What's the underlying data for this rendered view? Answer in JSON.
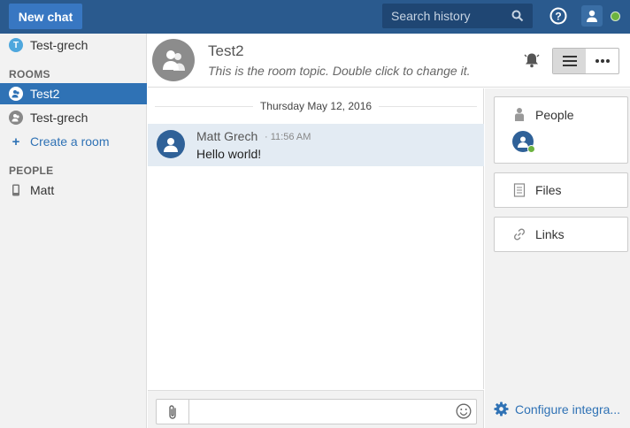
{
  "topbar": {
    "new_chat_label": "New chat",
    "search_placeholder": "Search history"
  },
  "sidebar": {
    "direct_item": "Test-grech",
    "direct_badge": "T",
    "rooms_heading": "ROOMS",
    "rooms": [
      {
        "label": "Test2",
        "active": true
      },
      {
        "label": "Test-grech",
        "active": false
      }
    ],
    "create_room": "Create a room",
    "people_heading": "PEOPLE",
    "people": [
      {
        "label": "Matt"
      }
    ]
  },
  "room": {
    "title": "Test2",
    "topic": "This is the room topic. Double click to change it."
  },
  "chat": {
    "date_separator": "Thursday May 12, 2016",
    "messages": [
      {
        "author": "Matt Grech",
        "time": "11:56 AM",
        "text": "Hello world!"
      }
    ]
  },
  "input": {
    "value": "",
    "placeholder": ""
  },
  "right_panel": {
    "people_label": "People",
    "files_label": "Files",
    "links_label": "Links",
    "configure_label": "Configure integra..."
  },
  "colors": {
    "topbar": "#2a5a8e",
    "accent": "#2f72b5",
    "online": "#6cb33f"
  }
}
